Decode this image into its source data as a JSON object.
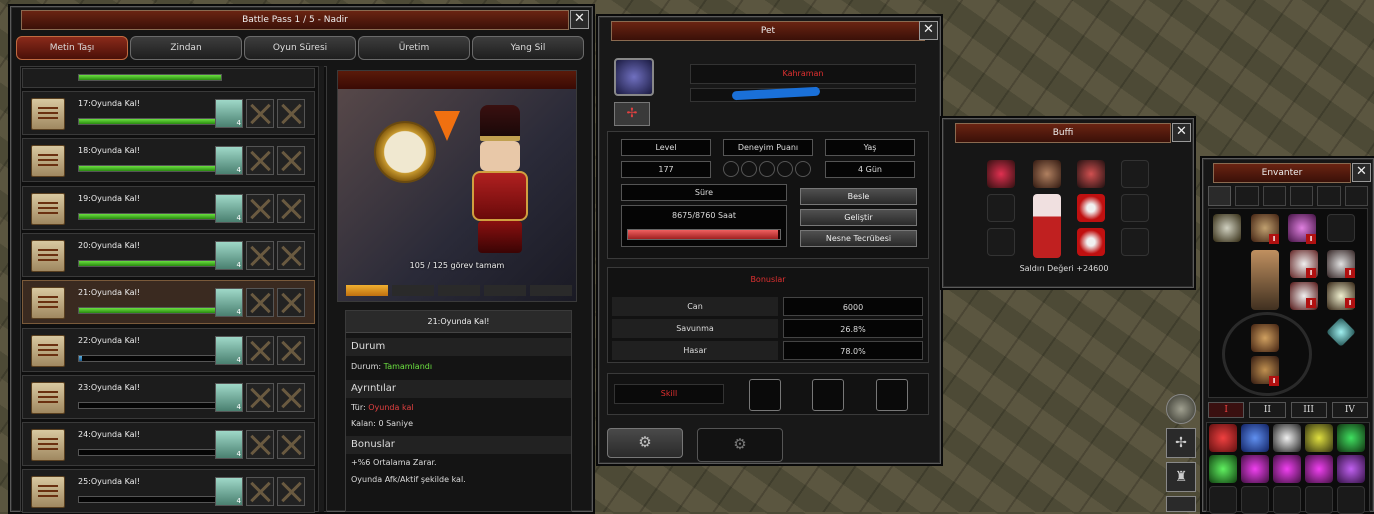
{
  "battle_pass": {
    "title": "Battle Pass 1 / 5 - Nadir",
    "close": "✕",
    "tabs": [
      "Metin Taşı",
      "Zindan",
      "Oyun Süresi",
      "Üretim",
      "Yang Sil"
    ],
    "quests": [
      {
        "label": "17:Oyunda Kal!",
        "progress": 1.0
      },
      {
        "label": "18:Oyunda Kal!",
        "progress": 1.0
      },
      {
        "label": "19:Oyunda Kal!",
        "progress": 1.0
      },
      {
        "label": "20:Oyunda Kal!",
        "progress": 1.0
      },
      {
        "label": "21:Oyunda Kal!",
        "progress": 1.0,
        "selected": true
      },
      {
        "label": "22:Oyunda Kal!",
        "progress": 0.02
      },
      {
        "label": "23:Oyunda Kal!",
        "progress": 0
      },
      {
        "label": "24:Oyunda Kal!",
        "progress": 0
      },
      {
        "label": "25:Oyunda Kal!",
        "progress": 0
      }
    ],
    "reward_count": "4",
    "preview_caption": "105 / 125 görev tamam",
    "preview_progress": 0.2,
    "detail": {
      "title": "21:Oyunda Kal!",
      "durum_header": "Durum",
      "durum_label": "Durum:",
      "durum_value": "Tamamlandı",
      "ayrintilar_header": "Ayrıntılar",
      "tur_label": "Tür:",
      "tur_value": "Oyunda kal",
      "kalan": "Kalan: 0 Saniye",
      "bonuslar_header": "Bonuslar",
      "bonus1": "+%6 Ortalama Zarar.",
      "bonus2": "Oyunda Afk/Aktif şekilde kal."
    }
  },
  "pet": {
    "title": "Pet",
    "close": "✕",
    "name": "Kahraman",
    "level_label": "Level",
    "level_value": "177",
    "exp_label": "Deneyim Puanı",
    "age_label": "Yaş",
    "age_value": "4  Gün",
    "time_label": "Süre",
    "time_value": "8675/8760 Saat",
    "time_progress": 0.99,
    "btn_feed": "Besle",
    "btn_evolve": "Geliştir",
    "btn_item_exp": "Nesne Tecrübesi",
    "bonus_header": "Bonuslar",
    "bonuses": [
      {
        "name": "Can",
        "value": "6000"
      },
      {
        "name": "Savunma",
        "value": "26.8%"
      },
      {
        "name": "Hasar",
        "value": "78.0%"
      }
    ],
    "skill_label": "Skill"
  },
  "buff": {
    "title": "Buffi",
    "close": "✕",
    "attack_value": "Saldırı Değeri +24600"
  },
  "inventory": {
    "title": "Envanter",
    "close": "✕",
    "pages": [
      "I",
      "II",
      "III",
      "IV"
    ],
    "item_badge": "I"
  },
  "colors": {
    "accent_red": "#e03030",
    "green": "#6be040",
    "title_red": "#5a1a0a"
  }
}
